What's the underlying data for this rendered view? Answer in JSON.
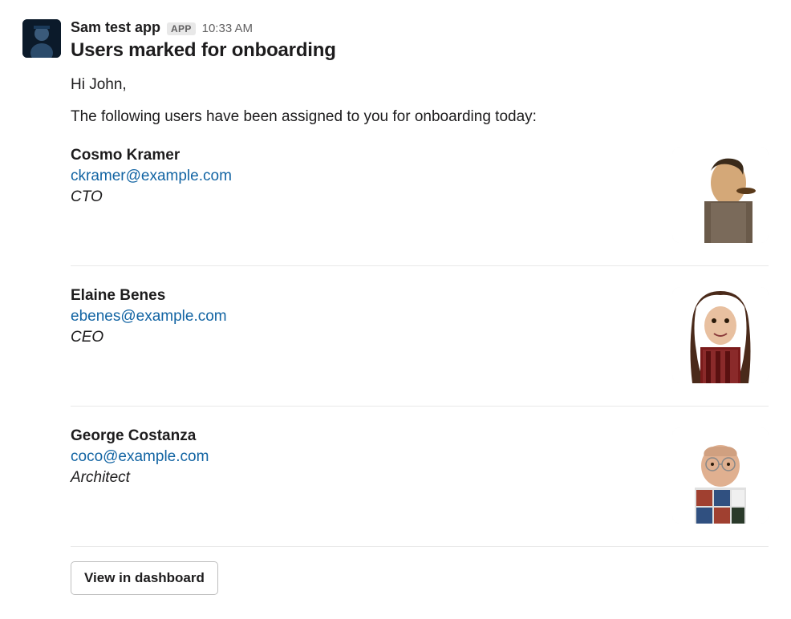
{
  "message": {
    "app_name": "Sam test app",
    "app_badge": "APP",
    "timestamp": "10:33 AM",
    "title": "Users marked for onboarding",
    "greeting": "Hi John,",
    "intro": "The following users have been assigned to you for onboarding today:",
    "users": [
      {
        "name": "Cosmo Kramer",
        "email": "ckramer@example.com",
        "title": "CTO"
      },
      {
        "name": "Elaine Benes",
        "email": "ebenes@example.com",
        "title": "CEO"
      },
      {
        "name": "George Costanza",
        "email": "coco@example.com",
        "title": "Architect"
      }
    ],
    "action_button": "View in dashboard"
  }
}
